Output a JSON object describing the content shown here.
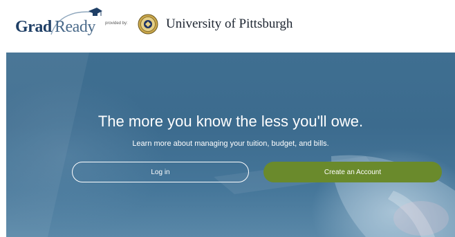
{
  "header": {
    "logo_grad": "Grad",
    "logo_ready": "Ready",
    "provided_by": "provided by:",
    "university": "University of Pittsburgh"
  },
  "hero": {
    "headline": "The more you know the less you'll owe.",
    "subline": "Learn more about managing your tuition, budget, and bills.",
    "login_label": "Log in",
    "create_label": "Create an Account"
  },
  "colors": {
    "brand_navy": "#1f3f66",
    "hero_blue": "#3f6f91",
    "create_button": "#6a8a2c"
  },
  "icons": [
    "graduation-cap-icon",
    "university-seal-icon"
  ]
}
